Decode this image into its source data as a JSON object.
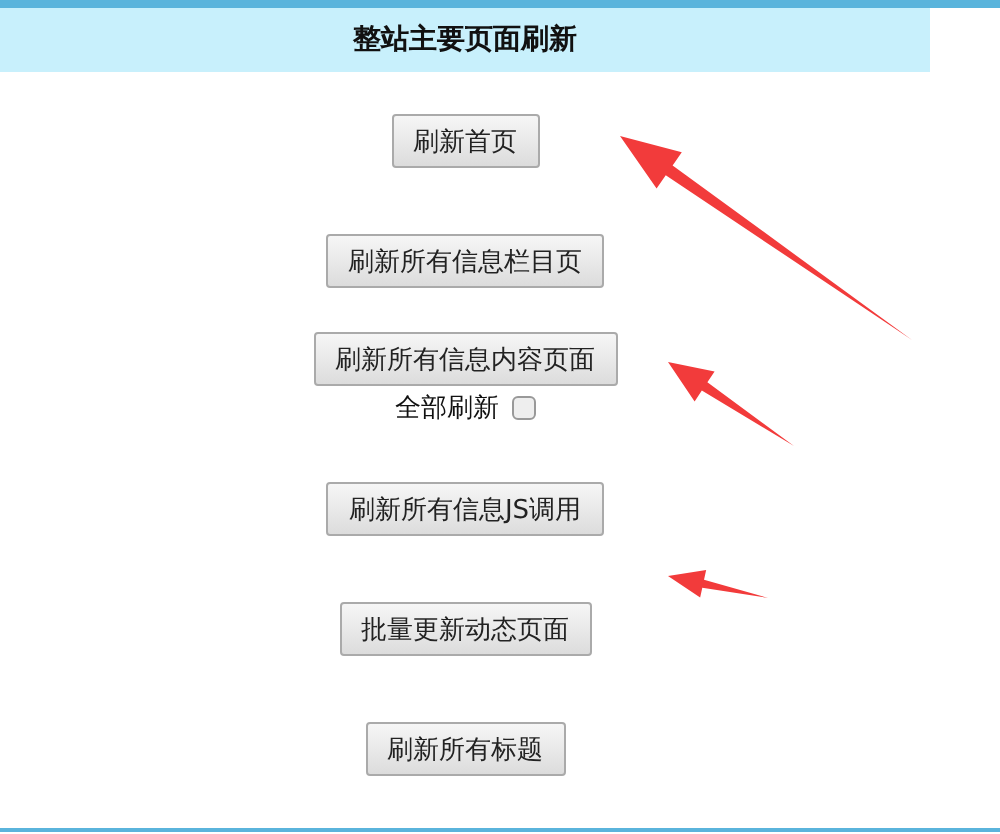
{
  "header": {
    "title": "整站主要页面刷新"
  },
  "items": [
    {
      "kind": "button",
      "label": "刷新首页"
    },
    {
      "kind": "button",
      "label": "刷新所有信息栏目页"
    },
    {
      "kind": "button",
      "label": "刷新所有信息内容页面"
    },
    {
      "kind": "checkbox",
      "label": "全部刷新",
      "checked": false
    },
    {
      "kind": "button",
      "label": "刷新所有信息JS调用"
    },
    {
      "kind": "button",
      "label": "批量更新动态页面"
    },
    {
      "kind": "button",
      "label": "刷新所有标题"
    }
  ]
}
